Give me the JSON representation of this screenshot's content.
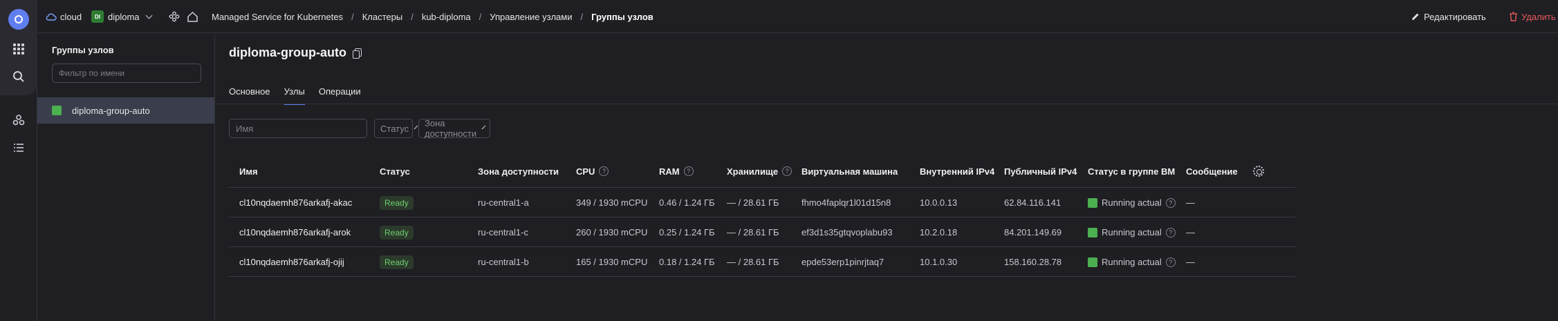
{
  "header": {
    "cloud": "cloud",
    "folder_badge": "DI",
    "folder": "diploma",
    "breadcrumbs": [
      "Managed Service for Kubernetes",
      "Кластеры",
      "kub-diploma",
      "Управление узлами",
      "Группы узлов"
    ],
    "edit_label": "Редактировать",
    "delete_label": "Удалить"
  },
  "sidebar": {
    "title": "Группы узлов",
    "filter_placeholder": "Фильтр по имени",
    "items": [
      {
        "label": "diploma-group-auto"
      }
    ]
  },
  "main": {
    "title": "diploma-group-auto",
    "tabs": [
      {
        "label": "Основное",
        "active": false
      },
      {
        "label": "Узлы",
        "active": true
      },
      {
        "label": "Операции",
        "active": false
      }
    ],
    "filters": {
      "name_placeholder": "Имя",
      "status_label": "Статус",
      "zone_label": "Зона доступности"
    }
  },
  "table": {
    "columns": {
      "name": "Имя",
      "status": "Статус",
      "zone": "Зона доступности",
      "cpu": "CPU",
      "ram": "RAM",
      "storage": "Хранилище",
      "vm": "Виртуальная машина",
      "ipv4_internal": "Внутренний IPv4",
      "ipv4_public": "Публичный IPv4",
      "vm_status": "Статус в группе ВМ",
      "message": "Сообщение"
    },
    "help_glyph": "?",
    "rows": [
      {
        "name": "cl10nqdaemh876arkafj-akac",
        "status": "Ready",
        "zone": "ru-central1-a",
        "cpu": "349 / 1930 mCPU",
        "ram": "0.46 / 1.24 ГБ",
        "storage": "— / 28.61 ГБ",
        "vm": "fhmo4faplqr1l01d15n8",
        "ipv4_internal": "10.0.0.13",
        "ipv4_public": "62.84.116.141",
        "vm_status": "Running actual",
        "message": "—"
      },
      {
        "name": "cl10nqdaemh876arkafj-arok",
        "status": "Ready",
        "zone": "ru-central1-c",
        "cpu": "260 / 1930 mCPU",
        "ram": "0.25 / 1.24 ГБ",
        "storage": "— / 28.61 ГБ",
        "vm": "ef3d1s35gtqvoplabu93",
        "ipv4_internal": "10.2.0.18",
        "ipv4_public": "84.201.149.69",
        "vm_status": "Running actual",
        "message": "—"
      },
      {
        "name": "cl10nqdaemh876arkafj-ojij",
        "status": "Ready",
        "zone": "ru-central1-b",
        "cpu": "165 / 1930 mCPU",
        "ram": "0.18 / 1.24 ГБ",
        "storage": "— / 28.61 ГБ",
        "vm": "epde53erp1pinrjtaq7",
        "ipv4_internal": "10.1.0.30",
        "ipv4_public": "158.160.28.78",
        "vm_status": "Running actual",
        "message": "—"
      }
    ]
  },
  "colors": {
    "accent": "#5f7ef0",
    "ok_green": "#4caf50",
    "danger": "#e85a5a"
  }
}
